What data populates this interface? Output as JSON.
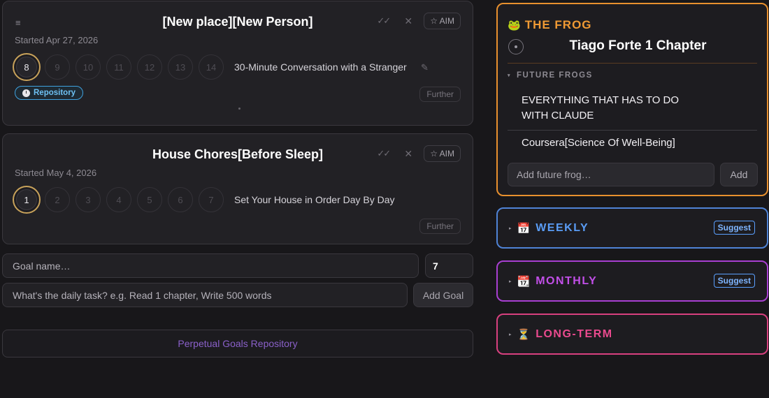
{
  "goals": [
    {
      "menu_icon": "≡",
      "title": "[New place][New Person]",
      "check_icon": "✓✓",
      "close_icon": "✕",
      "aim_label": "☆ AIM",
      "started": "Started Apr 27, 2026",
      "days": [
        "8",
        "9",
        "10",
        "11",
        "12",
        "13",
        "14"
      ],
      "current_day_index": 0,
      "task": "30-Minute Conversation with a Stranger",
      "edit_icon": "✎",
      "badge": "Repository",
      "further_label": "Further"
    },
    {
      "title": "House Chores[Before Sleep]",
      "check_icon": "✓✓",
      "close_icon": "✕",
      "aim_label": "☆ AIM",
      "started": "Started May 4, 2026",
      "days": [
        "1",
        "2",
        "3",
        "4",
        "5",
        "6",
        "7"
      ],
      "current_day_index": 0,
      "task": "Set Your House in Order Day By Day",
      "further_label": "Further"
    }
  ],
  "new_goal": {
    "name_placeholder": "Goal name…",
    "days_value": "7",
    "task_placeholder": "What's the daily task? e.g. Read 1 chapter, Write 500 words",
    "add_label": "Add Goal"
  },
  "repository_link": "Perpetual Goals Repository",
  "frog": {
    "emoji": "🐸",
    "title": "THE FROG",
    "current": "Tiago Forte 1 Chapter",
    "future_label": "FUTURE FROGS",
    "future_items": [
      "EVERYTHING THAT HAS TO DO WITH CLAUDE",
      "Coursera[Science Of Well-Being]"
    ],
    "input_placeholder": "Add future frog…",
    "add_label": "Add",
    "accent": "#e8902e"
  },
  "periods": [
    {
      "emoji": "📅",
      "title": "WEEKLY",
      "color": "#5a9cf5",
      "border": "#4f83d6",
      "suggest": "Suggest"
    },
    {
      "emoji": "📆",
      "title": "MONTHLY",
      "color": "#c24fe8",
      "border": "#a83fd1",
      "suggest": "Suggest"
    },
    {
      "emoji": "⏳",
      "title": "LONG-TERM",
      "color": "#ea4a8e",
      "border": "#d8407f"
    }
  ],
  "arrow_glyph": "▸"
}
